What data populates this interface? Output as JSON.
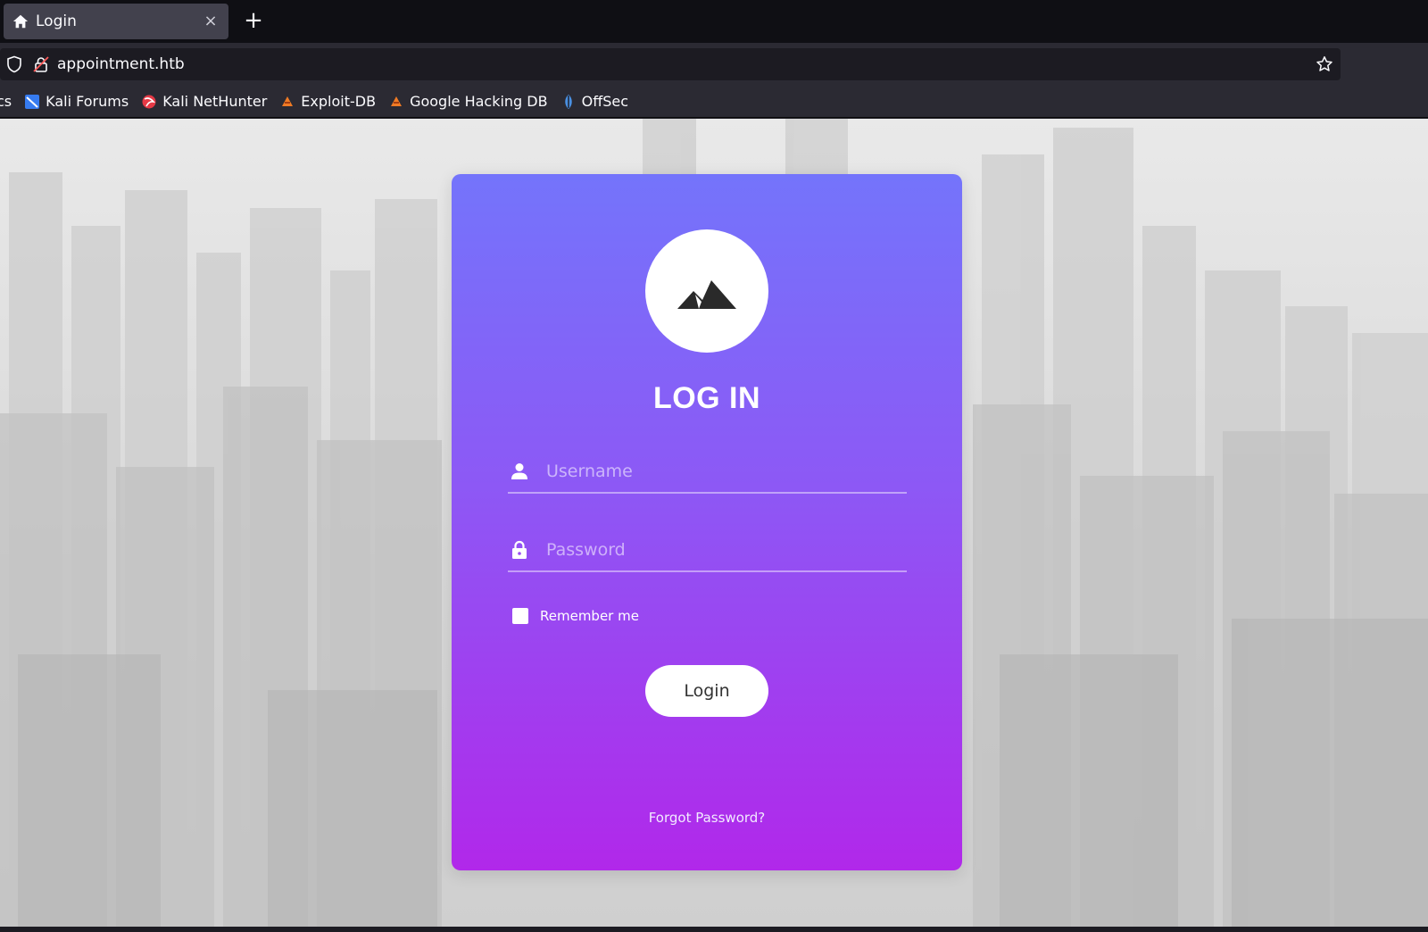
{
  "browser": {
    "tab": {
      "title": "Login",
      "close": "×"
    },
    "new_tab": "+",
    "url": "appointment.htb",
    "bookmarks": [
      {
        "label": "cs",
        "icon": "kali-docs-icon"
      },
      {
        "label": "Kali Forums",
        "icon": "kali-forums-icon"
      },
      {
        "label": "Kali NetHunter",
        "icon": "kali-nethunter-icon"
      },
      {
        "label": "Exploit-DB",
        "icon": "exploit-db-icon"
      },
      {
        "label": "Google Hacking DB",
        "icon": "ghdb-icon"
      },
      {
        "label": "OffSec",
        "icon": "offsec-icon"
      }
    ]
  },
  "login": {
    "logo": "mountain-icon",
    "title": "LOG IN",
    "username_placeholder": "Username",
    "password_placeholder": "Password",
    "remember_label": "Remember me",
    "button_label": "Login",
    "forgot_label": "Forgot Password?"
  },
  "colors": {
    "gradient_top": "#7474fb",
    "gradient_bottom": "#b128ea"
  }
}
